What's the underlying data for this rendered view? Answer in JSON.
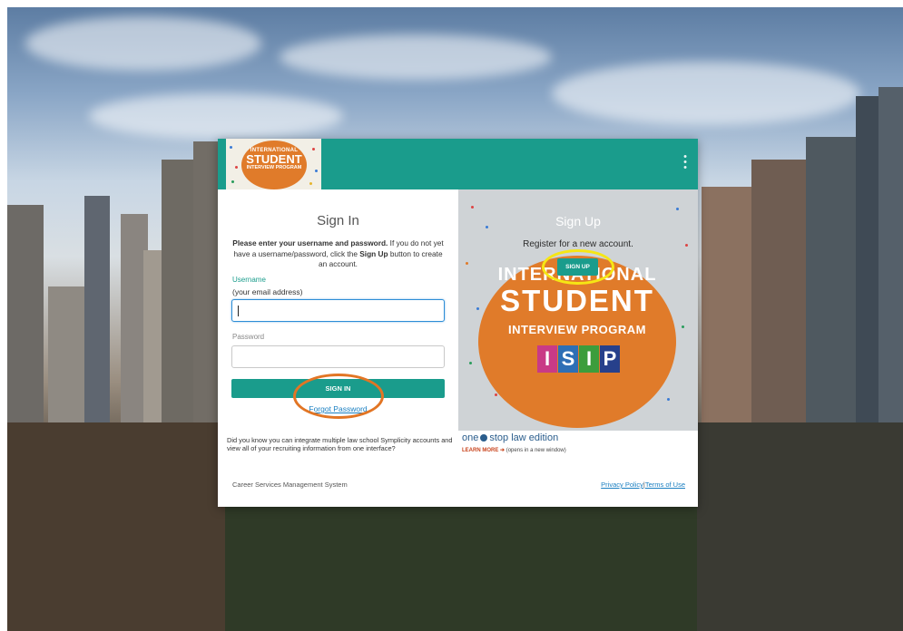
{
  "logo": {
    "line1": "INTERNATIONAL",
    "line2": "STUDENT",
    "line3": "INTERVIEW PROGRAM"
  },
  "signin": {
    "title": "Sign In",
    "desc_part1": "Please enter your username and password.",
    "desc_part2": " If you do not yet have a username/password, click the ",
    "desc_bold": "Sign Up",
    "desc_part3": " button to create an account.",
    "username_label": "Username",
    "username_hint": "(your email address)",
    "password_label": "Password",
    "signin_button": "SIGN IN",
    "forgot_link": "Forgot Password"
  },
  "signup": {
    "title": "Sign Up",
    "subtitle": "Register for a new account.",
    "button": "SIGN UP",
    "banner_line1": "INTERNATIONAL",
    "banner_line2": "STUDENT",
    "banner_line3": "INTERVIEW PROGRAM",
    "banner_letters": [
      "I",
      "S",
      "I",
      "P"
    ]
  },
  "promo": {
    "text": "Did you know you can integrate multiple law school Symplicity accounts and view all of your recruiting information from one interface?",
    "brand_one": "one",
    "brand_stop": "stop",
    "brand_edition": "law edition",
    "learn_more": "LEARN MORE",
    "learn_suffix": "(opens in a new window)"
  },
  "footer": {
    "left": "Career Services Management System",
    "privacy": "Privacy Policy",
    "separator": "|",
    "terms": "Terms of Use"
  },
  "colors": {
    "teal": "#1a9c8c",
    "orange": "#e07b2a",
    "link": "#1a7fc1",
    "highlight_yellow": "#f6e614",
    "highlight_orange": "#e27524"
  }
}
